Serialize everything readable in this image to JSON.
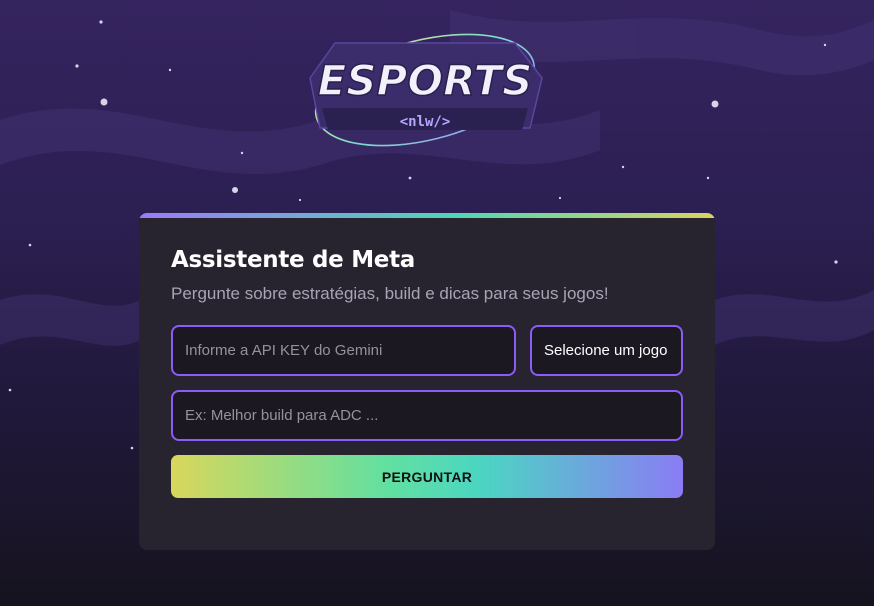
{
  "logo": {
    "title": "ESPORTS",
    "tag": "<nlw/>"
  },
  "card": {
    "title": "Assistente de Meta",
    "subtitle": "Pergunte sobre estratégias, build e dicas para seus jogos!"
  },
  "form": {
    "api_key_placeholder": "Informe a API KEY do Gemini",
    "api_key_value": "",
    "game_select_value": "Selecione um jogo",
    "question_placeholder": "Ex: Melhor build para ADC ...",
    "question_value": "",
    "submit_label": "PERGUNTAR"
  },
  "colors": {
    "background_top": "#35245f",
    "background_bottom": "#16131f",
    "card": "#27232f",
    "input_border": "#8b5cf6",
    "accent_yellow": "#d8d75b",
    "accent_green": "#4bd6c2",
    "accent_purple": "#8a7cf5"
  }
}
